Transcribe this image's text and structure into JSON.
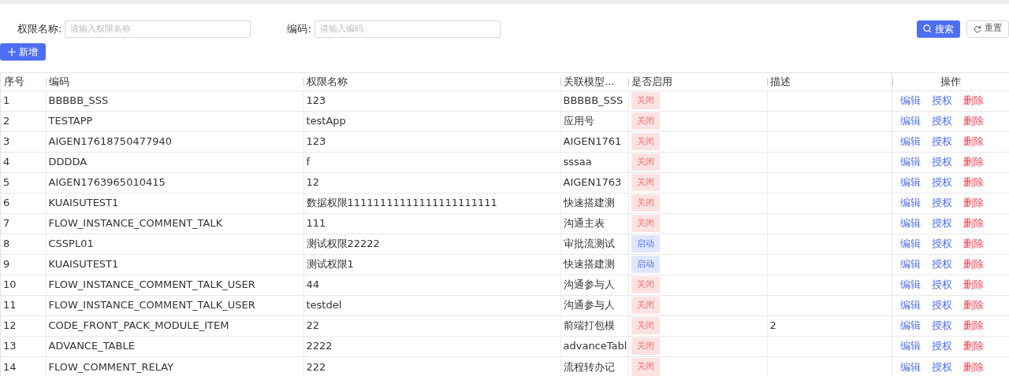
{
  "filters": [
    {
      "label": "权限名称:",
      "placeholder": "请输入权限名称"
    },
    {
      "label": "编码:",
      "placeholder": "请输入编码"
    }
  ],
  "search_button": "搜索",
  "reset_button": "重置",
  "add_button": "新增",
  "table": {
    "columns": [
      "序号",
      "编码",
      "权限名称",
      "关联模型...",
      "是否启用",
      "描述",
      "操作"
    ],
    "rows": [
      {
        "index": "1",
        "code": "BBBBB_SSS",
        "name": "123",
        "model": "BBBBB_SSS",
        "enabled": false,
        "status": "关闭",
        "description": "",
        "actions": [
          "编辑",
          "授权",
          "删除"
        ]
      },
      {
        "index": "2",
        "code": "TESTAPP",
        "name": "testApp",
        "model": "应用号",
        "enabled": false,
        "status": "关闭",
        "description": "",
        "actions": [
          "编辑",
          "授权",
          "删除"
        ]
      },
      {
        "index": "3",
        "code": "AIGEN17618750477940",
        "name": "123",
        "model": "AIGEN1761",
        "enabled": false,
        "status": "关闭",
        "description": "",
        "actions": [
          "编辑",
          "授权",
          "删除"
        ]
      },
      {
        "index": "4",
        "code": "DDDDA",
        "name": "f",
        "model": "sssaa",
        "enabled": false,
        "status": "关闭",
        "description": "",
        "actions": [
          "编辑",
          "授权",
          "删除"
        ]
      },
      {
        "index": "5",
        "code": "AIGEN1763965010415",
        "name": "12",
        "model": "AIGEN1763",
        "enabled": false,
        "status": "关闭",
        "description": "",
        "actions": [
          "编辑",
          "授权",
          "删除"
        ]
      },
      {
        "index": "6",
        "code": "KUAISUTEST1",
        "name": "数据权限11111111111111111111111",
        "model": "快速搭建测",
        "enabled": false,
        "status": "关闭",
        "description": "",
        "actions": [
          "编辑",
          "授权",
          "删除"
        ]
      },
      {
        "index": "7",
        "code": "FLOW_INSTANCE_COMMENT_TALK",
        "name": "111",
        "model": "沟通主表",
        "enabled": false,
        "status": "关闭",
        "description": "",
        "actions": [
          "编辑",
          "授权",
          "删除"
        ]
      },
      {
        "index": "8",
        "code": "CSSPL01",
        "name": "测试权限22222",
        "model": "审批流测试",
        "enabled": true,
        "status": "启动",
        "description": "",
        "actions": [
          "编辑",
          "授权",
          "删除"
        ]
      },
      {
        "index": "9",
        "code": "KUAISUTEST1",
        "name": "测试权限1",
        "model": "快速搭建测",
        "enabled": true,
        "status": "启动",
        "description": "",
        "actions": [
          "编辑",
          "授权",
          "删除"
        ]
      },
      {
        "index": "10",
        "code": "FLOW_INSTANCE_COMMENT_TALK_USER",
        "name": "44",
        "model": "沟通参与人",
        "enabled": false,
        "status": "关闭",
        "description": "",
        "actions": [
          "编辑",
          "授权",
          "删除"
        ]
      },
      {
        "index": "11",
        "code": "FLOW_INSTANCE_COMMENT_TALK_USER",
        "name": "testdel",
        "model": "沟通参与人",
        "enabled": false,
        "status": "关闭",
        "description": "",
        "actions": [
          "编辑",
          "授权",
          "删除"
        ]
      },
      {
        "index": "12",
        "code": "CODE_FRONT_PACK_MODULE_ITEM",
        "name": "22",
        "model": "前端打包模",
        "enabled": false,
        "status": "关闭",
        "description": "2",
        "actions": [
          "编辑",
          "授权",
          "删除"
        ]
      },
      {
        "index": "13",
        "code": "ADVANCE_TABLE",
        "name": "2222",
        "model": "advanceTabl",
        "enabled": false,
        "status": "关闭",
        "description": "",
        "actions": [
          "编辑",
          "授权",
          "删除"
        ]
      },
      {
        "index": "14",
        "code": "FLOW_COMMENT_RELAY",
        "name": "222",
        "model": "流程转办记",
        "enabled": false,
        "status": "关闭",
        "description": "",
        "actions": [
          "编辑",
          "授权",
          "删除"
        ]
      }
    ]
  }
}
